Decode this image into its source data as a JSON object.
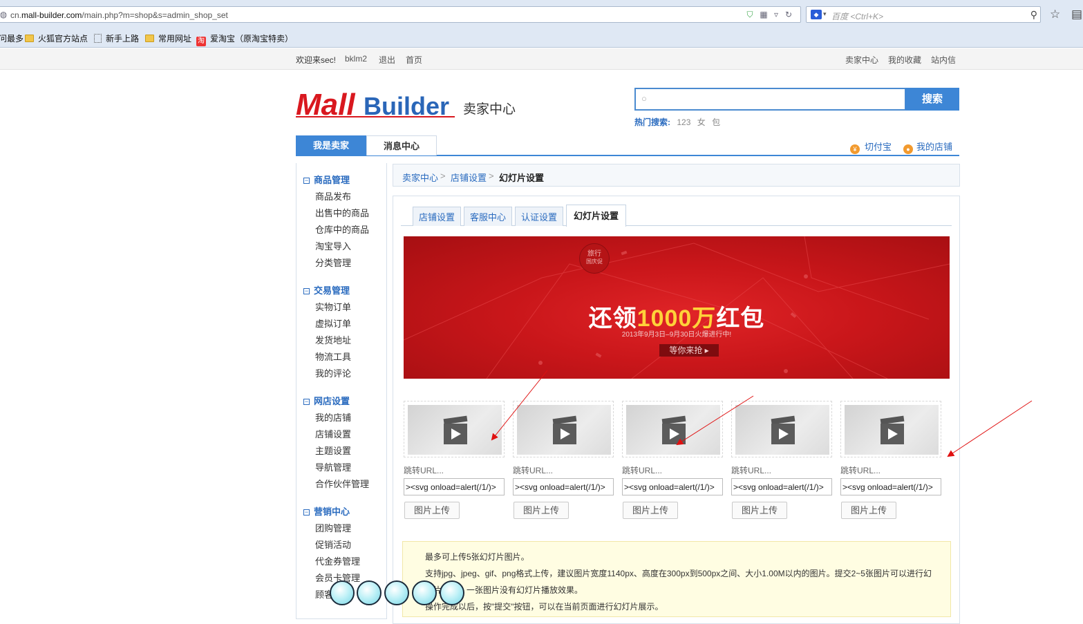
{
  "browser": {
    "url_prefix": "cn.",
    "url_host": "mall-builder.com",
    "url_path": "/main.php?m=shop&s=admin_shop_set",
    "search_placeholder": "百度 <Ctrl+K>",
    "search_engine_icon": "paw-icon",
    "bookmarks": [
      {
        "label": "问最多",
        "icon": "none"
      },
      {
        "label": "火狐官方站点",
        "icon": "folder-icon"
      },
      {
        "label": "新手上路",
        "icon": "page-icon"
      },
      {
        "label": "常用网址",
        "icon": "folder-icon"
      },
      {
        "label": "爱淘宝（原淘宝特卖）",
        "icon": "taobao-icon"
      }
    ],
    "taobao_glyph": "淘"
  },
  "topbar": {
    "welcome": "欢迎来sec!",
    "username": "bklm2",
    "logout": "退出",
    "home": "首页",
    "seller_center": "卖家中心",
    "favorites": "我的收藏",
    "messages": "站内信"
  },
  "header": {
    "logo_part1": "Mall",
    "logo_part2": "Builder",
    "title": "卖家中心",
    "search_button": "搜索",
    "hot_label": "热门搜索:",
    "hot_terms": [
      "123",
      "女",
      "包"
    ]
  },
  "nav": {
    "tabs": [
      "我是卖家",
      "消息中心"
    ],
    "right_links": [
      "切付宝",
      "我的店铺"
    ],
    "coin_glyph": "¥"
  },
  "sidebar": {
    "groups": [
      {
        "title": "商品管理",
        "items": [
          "商品发布",
          "出售中的商品",
          "仓库中的商品",
          "淘宝导入",
          "分类管理"
        ]
      },
      {
        "title": "交易管理",
        "items": [
          "实物订单",
          "虚拟订单",
          "发货地址",
          "物流工具",
          "我的评论"
        ]
      },
      {
        "title": "网店设置",
        "items": [
          "我的店铺",
          "店铺设置",
          "主题设置",
          "导航管理",
          "合作伙伴管理"
        ]
      },
      {
        "title": "营销中心",
        "items": [
          "团购管理",
          "促销活动",
          "代金券管理",
          "会员卡管理",
          "顾客"
        ]
      }
    ]
  },
  "breadcrumb": {
    "items": [
      "卖家中心",
      "店铺设置",
      "幻灯片设置"
    ],
    "separator": ">"
  },
  "tabs": [
    "店铺设置",
    "客服中心",
    "认证设置",
    "幻灯片设置"
  ],
  "banner": {
    "badge_line1": "旅行",
    "badge_line2": "国庆促",
    "title_part1": "还领",
    "title_highlight": "1000万",
    "title_part2": "红包",
    "subtitle": "2013年9月3日–9月30日火爆进行中!",
    "button": "等你来抢 ▸"
  },
  "slides": [
    {
      "label": "跳转URL...",
      "value": "><svg onload=alert(/1/)>",
      "upload": "图片上传"
    },
    {
      "label": "跳转URL...",
      "value": "><svg onload=alert(/1/)>",
      "upload": "图片上传"
    },
    {
      "label": "跳转URL...",
      "value": "><svg onload=alert(/1/)>",
      "upload": "图片上传"
    },
    {
      "label": "跳转URL...",
      "value": "><svg onload=alert(/1/)>",
      "upload": "图片上传"
    },
    {
      "label": "跳转URL...",
      "value": "><svg onload=alert(/1/)>",
      "upload": "图片上传"
    }
  ],
  "notice": {
    "lines": [
      "最多可上传5张幻灯片图片。",
      "支持jpg、jpeg、gif、png格式上传，建议图片宽度1140px、高度在300px到500px之间、大小1.00M以内的图片。提交2~5张图片可以进行幻",
      "灯片播放，一张图片没有幻灯片播放效果。",
      "操作完成以后，按\"提交\"按钮，可以在当前页面进行幻灯片展示。"
    ]
  },
  "colors": {
    "accent": "#3d86d6",
    "link": "#2a6bbf",
    "banner_red": "#c9161a",
    "logo_red": "#d9181f",
    "arrow_red": "#e01010"
  }
}
